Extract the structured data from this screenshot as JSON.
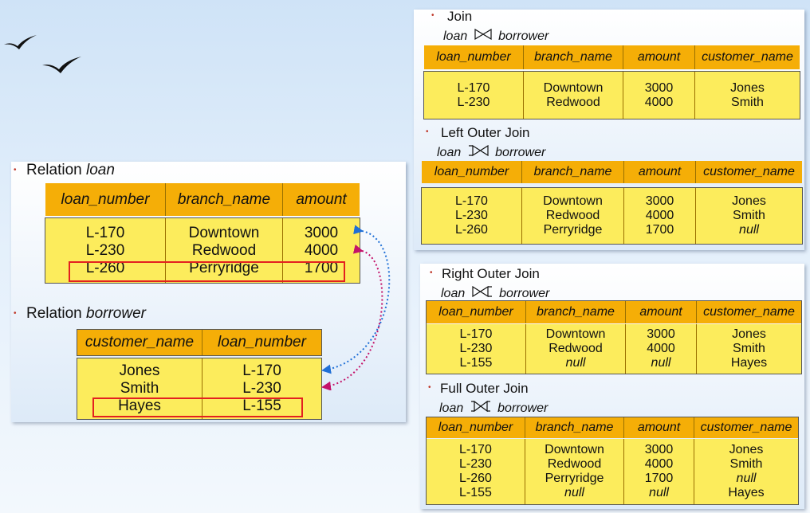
{
  "loan_panel": {
    "loan_title_prefix": "Relation ",
    "loan_title_name": "loan",
    "loan_headers": [
      "loan_number",
      "branch_name",
      "amount"
    ],
    "loan_rows": [
      [
        "L-170",
        "Downtown",
        "3000"
      ],
      [
        "L-230",
        "Redwood",
        "4000"
      ],
      [
        "L-260",
        "Perryridge",
        "1700"
      ]
    ],
    "borrower_title_prefix": "Relation ",
    "borrower_title_name": "borrower",
    "borrower_headers": [
      "customer_name",
      "loan_number"
    ],
    "borrower_rows": [
      [
        "Jones",
        "L-170"
      ],
      [
        "Smith",
        "L-230"
      ],
      [
        "Hayes",
        "L-155"
      ]
    ]
  },
  "join_panel": {
    "join_title": "Join",
    "join_expr_left": "loan",
    "join_expr_right": "borrower",
    "headers": [
      "loan_number",
      "branch_name",
      "amount",
      "customer_name"
    ],
    "join_rows": [
      [
        "L-170",
        "Downtown",
        "3000",
        "Jones"
      ],
      [
        "L-230",
        "Redwood",
        "4000",
        "Smith"
      ]
    ],
    "left_title": "Left Outer Join",
    "left_expr_left": "loan",
    "left_expr_right": "borrower",
    "left_rows": [
      [
        "L-170",
        "Downtown",
        "3000",
        "Jones"
      ],
      [
        "L-230",
        "Redwood",
        "4000",
        "Smith"
      ],
      [
        "L-260",
        "Perryridge",
        "1700",
        "null"
      ]
    ]
  },
  "outer_panel": {
    "right_title": "Right Outer Join",
    "right_expr_left": "loan",
    "right_expr_right": "borrower",
    "headers": [
      "loan_number",
      "branch_name",
      "amount",
      "customer_name"
    ],
    "right_rows": [
      [
        "L-170",
        "Downtown",
        "3000",
        "Jones"
      ],
      [
        "L-230",
        "Redwood",
        "4000",
        "Smith"
      ],
      [
        "L-155",
        "null",
        "null",
        "Hayes"
      ]
    ],
    "full_title": "Full Outer Join",
    "full_expr_left": "loan",
    "full_expr_right": "borrower",
    "full_rows": [
      [
        "L-170",
        "Downtown",
        "3000",
        "Jones"
      ],
      [
        "L-230",
        "Redwood",
        "4000",
        "Smith"
      ],
      [
        "L-260",
        "Perryridge",
        "1700",
        "null"
      ],
      [
        "L-155",
        "null",
        "null",
        "Hayes"
      ]
    ]
  },
  "colors": {
    "header_fill": "#f5ae07",
    "body_fill": "#fcec5c",
    "highlight_border": "#e32020",
    "arrow_blue": "#1f6fd6",
    "arrow_magenta": "#c4136a"
  },
  "icons": [
    "bird-icon",
    "bird-icon",
    "bullet-icon"
  ]
}
